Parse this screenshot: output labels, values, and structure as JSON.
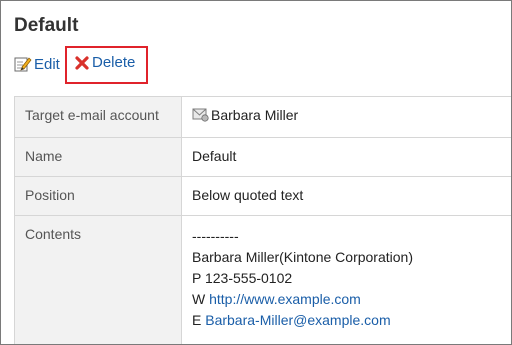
{
  "page": {
    "title": "Default"
  },
  "toolbar": {
    "edit_label": "Edit",
    "delete_label": "Delete"
  },
  "details": {
    "target_label": "Target e-mail account",
    "target_value": "Barbara Miller",
    "name_label": "Name",
    "name_value": "Default",
    "position_label": "Position",
    "position_value": "Below quoted text",
    "contents_label": "Contents",
    "signature": {
      "separator": "----------",
      "line1": "Barbara Miller(Kintone Corporation)",
      "phone": "P 123-555-0102",
      "web_prefix": "W ",
      "web_url": "http://www.example.com",
      "email_prefix": "E ",
      "email": "Barbara-Miller@example.com"
    }
  },
  "icons": {
    "edit": "edit-pencil-icon",
    "delete": "delete-x-icon",
    "account": "mail-account-icon"
  },
  "colors": {
    "link": "#1a5ea8",
    "highlight": "#e0232b",
    "delete_x": "#d9312b",
    "label_bg": "#f2f2f2"
  }
}
